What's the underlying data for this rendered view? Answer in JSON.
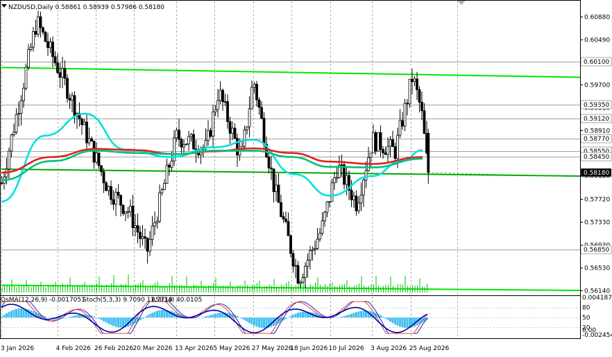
{
  "header": {
    "symbol_line": "NZDUSD,Daily  0.58861 0.58939 0.57986 0.58180",
    "menu_arrow": "triangle-down-icon"
  },
  "indicator_line": {
    "osma": "OsMA(12,26,9) -0.0017051",
    "stoch": "Stoch(5,3,3) 9.7090 11.7719",
    "rsi": "RSI(14) 40.0105"
  },
  "chart_data": {
    "type": "candlestick",
    "symbol": "NZDUSD",
    "timeframe": "Daily",
    "ohlc_last": {
      "open": 0.58861,
      "high": 0.58939,
      "low": 0.57986,
      "close": 0.5818
    },
    "ylim": [
      0.5613,
      0.6104
    ],
    "price_ticks": [
      "0.60880",
      "0.60490",
      "0.59700",
      "0.59310",
      "0.58910",
      "0.58520",
      "0.58130",
      "0.57720",
      "0.57330",
      "0.56930",
      "0.56530",
      "0.56140"
    ],
    "price_tick_values": [
      0.6088,
      0.6049,
      0.597,
      0.5931,
      0.5891,
      0.5852,
      0.5813,
      0.5772,
      0.5733,
      0.5693,
      0.5653,
      0.5614
    ],
    "tagged_levels": [
      {
        "label": "0.60100",
        "value": 0.601
      },
      {
        "label": "0.59350",
        "value": 0.5935
      },
      {
        "label": "0.59120",
        "value": 0.5912
      },
      {
        "label": "0.58770",
        "value": 0.5877
      },
      {
        "label": "0.58550",
        "value": 0.5855
      },
      {
        "label": "0.58450",
        "value": 0.5845
      },
      {
        "label": "0.58180",
        "value": 0.5818,
        "current": true
      },
      {
        "label": "0.56850",
        "value": 0.5685
      }
    ],
    "x_labels": [
      "3 Jan 2026",
      "4 Feb 2026",
      "26 Feb 2026",
      "20 Mar 2026",
      "13 Apr 2026",
      "5 May 2026",
      "27 May 2026",
      "18 Jun 2026",
      "10 Jul 2026",
      "3 Aug 2026",
      "25 Aug 2026"
    ],
    "key_points": [
      {
        "date": "3 Jan 2026",
        "price": 0.58
      },
      {
        "date": "23 Jan 2026",
        "price": 0.608
      },
      {
        "date": "10 Feb 2026",
        "price": 0.596
      },
      {
        "date": "5 Mar 2026",
        "price": 0.579
      },
      {
        "date": "17 Mar 2026",
        "price": 0.575
      },
      {
        "date": "27 Mar 2026",
        "price": 0.568
      },
      {
        "date": "13 Apr 2026",
        "price": 0.588
      },
      {
        "date": "30 Apr 2026",
        "price": 0.586
      },
      {
        "date": "7 May 2026",
        "price": 0.596
      },
      {
        "date": "20 May 2026",
        "price": 0.584
      },
      {
        "date": "27 May 2026",
        "price": 0.598
      },
      {
        "date": "8 Jun 2026",
        "price": 0.579
      },
      {
        "date": "22 Jun 2026",
        "price": 0.5635
      },
      {
        "date": "5 Jul 2026",
        "price": 0.572
      },
      {
        "date": "14 Jul 2026",
        "price": 0.583
      },
      {
        "date": "25 Jul 2026",
        "price": 0.5765
      },
      {
        "date": "3 Aug 2026",
        "price": 0.5875
      },
      {
        "date": "16 Aug 2026",
        "price": 0.5855
      },
      {
        "date": "26 Aug 2026",
        "price": 0.5985
      },
      {
        "date": "31 Aug 2026",
        "price": 0.5925
      },
      {
        "date": "4 Sep 2026",
        "price": 0.5818
      }
    ],
    "trend_lines": [
      {
        "start": {
          "date": "3 Jan 2026",
          "price": 0.6
        },
        "end": {
          "date": "8 Sep 2026",
          "price": 0.5983
        },
        "color": "#00e600"
      },
      {
        "start": {
          "date": "3 Jan 2026",
          "price": 0.5824
        },
        "end": {
          "date": "8 Sep 2026",
          "price": 0.5812
        },
        "color": "#00aa00"
      },
      {
        "start": {
          "date": "3 Jan 2026",
          "price": 0.5623
        },
        "end": {
          "date": "8 Sep 2026",
          "price": 0.5614
        },
        "color": "#00e600"
      }
    ],
    "moving_averages": [
      {
        "color": "#00e0e0",
        "points": [
          {
            "date": "3 Jan 2026",
            "price": 0.5768
          },
          {
            "date": "28 Jan 2026",
            "price": 0.5882
          },
          {
            "date": "20 Feb 2026",
            "price": 0.592
          },
          {
            "date": "15 Mar 2026",
            "price": 0.5858
          },
          {
            "date": "10 Apr 2026",
            "price": 0.5845
          },
          {
            "date": "5 May 2026",
            "price": 0.5862
          },
          {
            "date": "27 May 2026",
            "price": 0.5875
          },
          {
            "date": "20 Jun 2026",
            "price": 0.5815
          },
          {
            "date": "10 Jul 2026",
            "price": 0.5778
          },
          {
            "date": "3 Aug 2026",
            "price": 0.5812
          },
          {
            "date": "20 Aug 2026",
            "price": 0.5838
          },
          {
            "date": "1 Sep 2026",
            "price": 0.5857
          }
        ]
      },
      {
        "color": "#e02020",
        "points": [
          {
            "date": "3 Jan 2026",
            "price": 0.5818
          },
          {
            "date": "1 Feb 2026",
            "price": 0.5845
          },
          {
            "date": "26 Feb 2026",
            "price": 0.5859
          },
          {
            "date": "20 Mar 2026",
            "price": 0.5857
          },
          {
            "date": "13 Apr 2026",
            "price": 0.585
          },
          {
            "date": "5 May 2026",
            "price": 0.5855
          },
          {
            "date": "27 May 2026",
            "price": 0.586
          },
          {
            "date": "18 Jun 2026",
            "price": 0.5852
          },
          {
            "date": "10 Jul 2026",
            "price": 0.5837
          },
          {
            "date": "3 Aug 2026",
            "price": 0.5833
          },
          {
            "date": "1 Sep 2026",
            "price": 0.5845
          }
        ]
      },
      {
        "color": "#00c080",
        "points": [
          {
            "date": "3 Jan 2026",
            "price": 0.5805
          },
          {
            "date": "1 Feb 2026",
            "price": 0.5838
          },
          {
            "date": "26 Feb 2026",
            "price": 0.5856
          },
          {
            "date": "20 Mar 2026",
            "price": 0.5852
          },
          {
            "date": "13 Apr 2026",
            "price": 0.585
          },
          {
            "date": "5 May 2026",
            "price": 0.5856
          },
          {
            "date": "27 May 2026",
            "price": 0.5856
          },
          {
            "date": "18 Jun 2026",
            "price": 0.5845
          },
          {
            "date": "10 Jul 2026",
            "price": 0.5828
          },
          {
            "date": "3 Aug 2026",
            "price": 0.5827
          },
          {
            "date": "1 Sep 2026",
            "price": 0.5842
          }
        ]
      }
    ],
    "volume_levels": [
      0.1,
      0.2,
      0.18,
      0.25,
      0.6,
      0.15
    ],
    "indicator_ticks": [
      "0.0041876",
      "80",
      "50",
      "20",
      "0.00",
      "-0.002454"
    ],
    "colors": {
      "background": "#ffffff",
      "candle": "#000000",
      "ma_fast": "#00e0e0",
      "ma_slow": "#e02020",
      "ma_mid": "#00c080",
      "trendline": "#00e600",
      "osma_histogram": "#40c0f0",
      "stoch_main": "#2020c0",
      "stoch_signal": "#e04040",
      "rsi_line": "#0000a0",
      "price_tag_bg": "#000000",
      "grid": "#c8c8c8"
    },
    "grid": true
  }
}
